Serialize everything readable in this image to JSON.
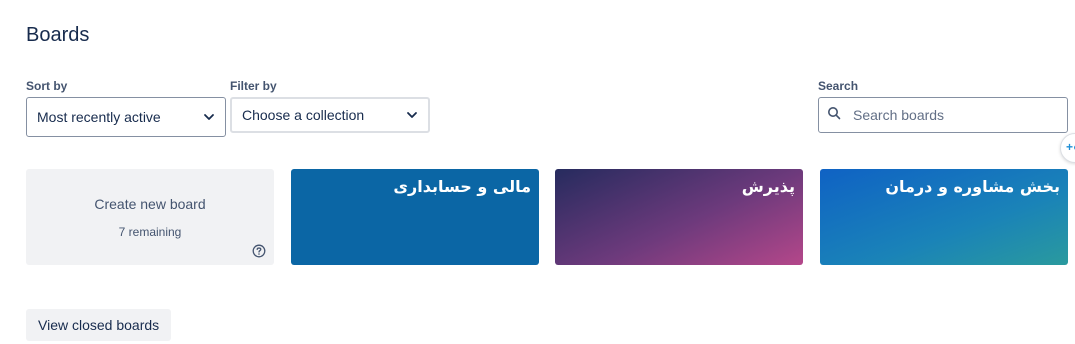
{
  "page": {
    "title": "Boards"
  },
  "sort": {
    "label": "Sort by",
    "value": "Most recently active"
  },
  "filter": {
    "label": "Filter by",
    "value": "Choose a collection"
  },
  "search": {
    "label": "Search",
    "placeholder": "Search boards"
  },
  "create_board": {
    "label": "Create new board",
    "remaining": "7 remaining"
  },
  "boards": [
    {
      "title": "مالی و حسابداری",
      "color": "#0b66a5"
    },
    {
      "title": "پذیرش",
      "color": "#6d3a7c"
    },
    {
      "title": "بخش مشاوره و درمان",
      "color": "#1a83b8"
    }
  ],
  "footer": {
    "view_closed_label": "View closed boards"
  },
  "icons": {
    "sort_chevron": "chevron-down-icon",
    "filter_chevron": "chevron-down-icon",
    "search": "search-icon",
    "help": "question-circle-icon",
    "floating": "plus-icon"
  }
}
